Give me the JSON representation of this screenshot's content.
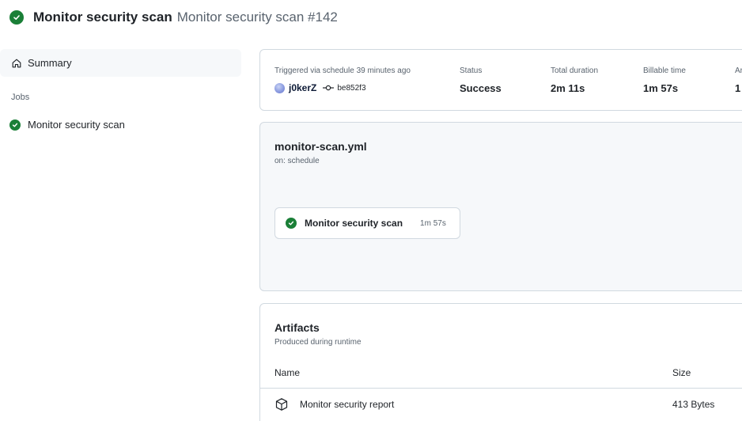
{
  "header": {
    "title": "Monitor security scan",
    "subtitle": "Monitor security scan #142"
  },
  "sidebar": {
    "summary_label": "Summary",
    "jobs_label": "Jobs",
    "jobs": [
      {
        "label": "Monitor security scan",
        "status": "success"
      }
    ]
  },
  "run_info": {
    "trigger_label": "Triggered via schedule 39 minutes ago",
    "actor": "j0kerZ",
    "commit_sha": "be852f3",
    "status_label": "Status",
    "status_value": "Success",
    "total_duration_label": "Total duration",
    "total_duration_value": "2m 11s",
    "billable_label": "Billable time",
    "billable_value": "1m 57s",
    "artifacts_label": "Ar",
    "artifacts_value": "1"
  },
  "workflow": {
    "file_name": "monitor-scan.yml",
    "trigger": "on: schedule",
    "job_name": "Monitor security scan",
    "job_duration": "1m 57s"
  },
  "artifacts": {
    "title": "Artifacts",
    "subtitle": "Produced during runtime",
    "col_name": "Name",
    "col_size": "Size",
    "rows": [
      {
        "name": "Monitor security report",
        "size": "413 Bytes"
      }
    ]
  },
  "colors": {
    "success": "#1a7f37",
    "border": "#d1d9e0",
    "muted_text": "#59636e",
    "panel_bg": "#f6f8fa"
  }
}
